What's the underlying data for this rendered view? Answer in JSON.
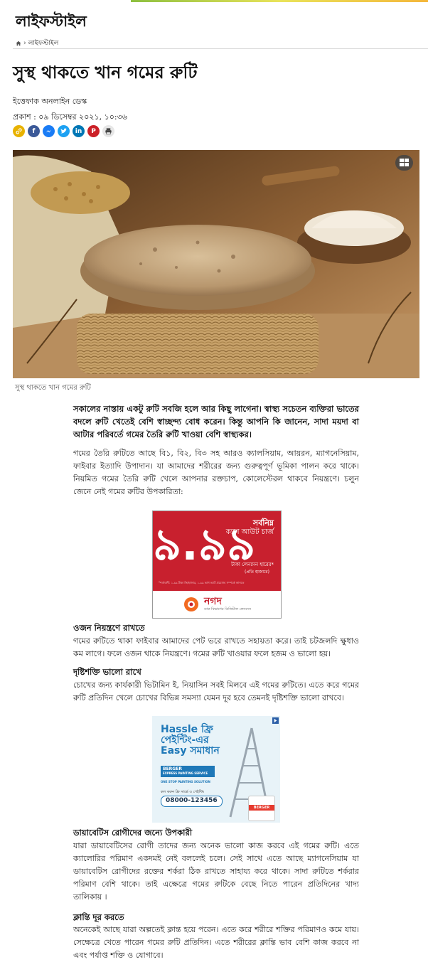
{
  "section": {
    "title": "লাইফস্টাইল"
  },
  "breadcrumb": {
    "current": "লাইফস্টাইল",
    "sep": "›"
  },
  "article": {
    "headline": "সুস্থ থাকতে খান গমের রুটি",
    "author": "ইত্তেফাক অনলাইন ডেস্ক",
    "published": "প্রকাশ : ০৯ ডিসেম্বর ২০২১, ১০:৩৬",
    "caption": "সুস্থ থাকতে খান গমের রুটি",
    "lead_lines": [
      "সকালের নাস্তায় একটু রুটি সবজি হলে আর কিছু লাগেনা। স্বাস্থ্য সচেতন ব্যক্তিরা ভাতের",
      "বদলে রুটি খেতেই বেশি স্বাচ্ছন্দ্য বোধ করেন। কিন্তু আপনি কি জানেন, সাদা ময়দা বা",
      "আটার পরিবর্তে গমের তৈরি রুটি খাওয়া বেশি স্বাস্থ্যকর।"
    ],
    "intro_lines": [
      "গমের তৈরি রুটিতে আছে বি১, বি২, বি৩ সহ আরও ক্যালসিয়াম, আয়রন, ম্যাগনেসিয়াম,",
      "ফাইবার ইত্যাদি উপাদান। যা আমাদের শরীরের জন্য গুরুত্বপূর্ণ ভূমিকা পালন করে থাকে।",
      "নিয়মিত গমের তৈরি রুটি খেলে আপনার রক্তচাপ, কোলেস্টেরল থাকবে নিয়ন্ত্রণে। চলুন জেনে",
      "নেই গমের রুটির উপকারিতা:"
    ],
    "sections": [
      {
        "heading": "ওজন নিয়ন্ত্রণে রাখতে",
        "lines": [
          "গমের রুটিতে থাকা ফাইবার আমাদের পেট ভরে রাখতে সহায়তা করে। তাই চটজলদি ক্ষুধাও",
          "কম লাগে। ফলে ওজন থাকে নিয়ন্ত্রণে। গমের রুটি খাওয়ার ফলে হজম ও ভালো হয়।"
        ]
      },
      {
        "heading": "দৃষ্টিশক্তি ভালো রাখে",
        "lines": [
          "চোখের জন্য কার্যকারী ভিটামিন ই, নিয়াসিন সবই মিলবে এই গমের রুটিতে। এতে করে গমের",
          "রুটি প্রতিদিন খেলে চোখের বিভিন্ন সমস্যা যেমন দূর হবে তেমনই দৃষ্টিশক্তি ভালো রাখবে।"
        ]
      },
      {
        "heading": "ডায়াবেটিস রোগীদের জন্যে উপকারী",
        "lines": [
          "যারা ডায়াবেটিসের রোগী তাদের জন্য অনেক ভালো কাজ করবে এই গমের রুটি। এতে",
          "ক্যালোরির পরিমাণ একদমই নেই বললেই চলে। সেই সাথে এতে আছে ম্যাগনেসিয়াম যা",
          "ডায়াবেটিস রোগীদের রক্তের শর্করা ঠিক রাখতে সাহায্য করে থাকে। সাদা রুটিতে শর্করার",
          "পরিমাণ বেশি থাকে। তাই এক্ষেত্রে গমের রুটিকে বেছে নিতে পারেন প্রতিদিনের খাদ্য তালিকায়",
          "।"
        ]
      },
      {
        "heading": "ক্লান্তি দূর করতে",
        "lines": [
          "অনেকেই আছে যারা অল্পতেই ক্লান্ত হয়ে পরেন। এতে করে শরীরে শক্তির পরিমাণও কমে যায়।",
          "সেক্ষেত্রে খেতে পারেন গমের রুটি প্রতিদিন। এতে শরীরের ক্লান্তি ভাব বেশি কাজ করবে না এবং",
          "পর্যাপ্ত শক্তি ও যোগাবে।"
        ]
      }
    ]
  },
  "ads": {
    "nagad": {
      "top": "সর্বনিম্ন",
      "sub": "ক্যাশ আউট চার্জ",
      "rate": "৯.৯৯",
      "unit": "টাকা লেনদেন হারের*",
      "note": "(প্রতি হাজারে)",
      "fine": "*শর্তাবলী: ১.৯৯ টাকা ফি/হাজার, ১.৯৯ ভাগ ভ্যাট প্রযোজ্য সম্পর্কে জানতে",
      "brand": "নগদ",
      "tagline": "ডাক বিভাগের ডিজিটাল লেনদেন",
      "color": "#c8202e"
    },
    "berger": {
      "line1": "Hassle ফ্রি",
      "line2": "পেইন্টিং-এর",
      "line3": "Easy সমাধান",
      "brand": "BERGER",
      "service": "EXPRESS PAINTING SERVICE",
      "solution": "ONE STOP PAINTING SOLUTION",
      "hotline_label": "কল করুন",
      "hotline_note": "ফ্রি সার্ভে ও পেইন্টিং",
      "hotline": "08000-123456",
      "can_label": "BERGER",
      "color": "#1e78b8"
    }
  },
  "share_icons": [
    "link-icon",
    "facebook-icon",
    "messenger-icon",
    "twitter-icon",
    "linkedin-icon",
    "pinterest-icon",
    "print-icon"
  ],
  "colors": {
    "facebook": "#3b5998",
    "messenger": "#1a7cf5",
    "twitter": "#1da1f2",
    "linkedin": "#0077b5",
    "pinterest": "#cb2027",
    "link": "#e8b200",
    "print": "#666666"
  }
}
